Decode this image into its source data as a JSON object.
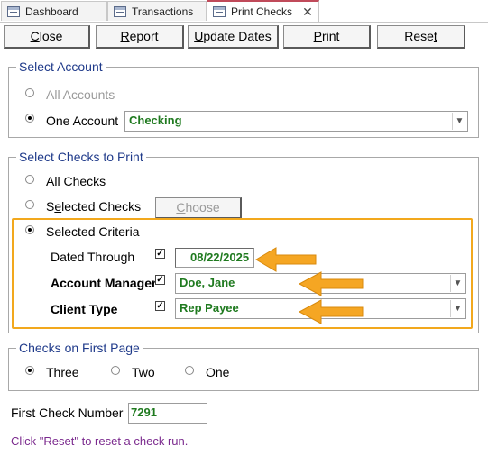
{
  "tabs": [
    {
      "label": "Dashboard"
    },
    {
      "label": "Transactions"
    },
    {
      "label": "Print Checks",
      "active": true
    }
  ],
  "toolbar": {
    "close": {
      "pre": "",
      "key": "C",
      "post": "lose"
    },
    "report": {
      "pre": "",
      "key": "R",
      "post": "eport"
    },
    "update_dates": {
      "pre": "",
      "key": "U",
      "post": "pdate Dates"
    },
    "print": {
      "pre": "",
      "key": "P",
      "post": "rint"
    },
    "reset": {
      "pre": "Rese",
      "key": "t",
      "post": ""
    }
  },
  "select_account": {
    "title": "Select Account",
    "all_accounts": "All Accounts",
    "one_account": "One Account",
    "account_value": "Checking",
    "selected": "one_account"
  },
  "select_checks": {
    "title": "Select Checks to Print",
    "all_checks": {
      "pre": "",
      "key": "A",
      "post": "ll Checks"
    },
    "selected_checks": {
      "pre": "S",
      "key": "e",
      "post": "lected Checks"
    },
    "choose": {
      "pre": "",
      "key": "C",
      "post": "hoose"
    },
    "selected_criteria": "Selected Criteria",
    "selected": "selected_criteria",
    "criteria": {
      "dated_through_label": "Dated Through",
      "dated_through_value": "08/22/2025",
      "account_manager_label": "Account Manager",
      "account_manager_value": "Doe, Jane",
      "client_type_label": "Client Type",
      "client_type_value": "Rep Payee"
    }
  },
  "first_page": {
    "title": "Checks on First Page",
    "three": "Three",
    "two": "Two",
    "one": "One",
    "selected": "three"
  },
  "first_check_number": {
    "label": "First Check Number",
    "value": "7291"
  },
  "note": "Click \"Reset\" to reset a check run.",
  "colors": {
    "accent_tab": "#c04a5a",
    "group_title": "#1f3a8a",
    "field_text": "#1f7a1f",
    "highlight": "#f2a81d",
    "note": "#7b2a8e"
  }
}
